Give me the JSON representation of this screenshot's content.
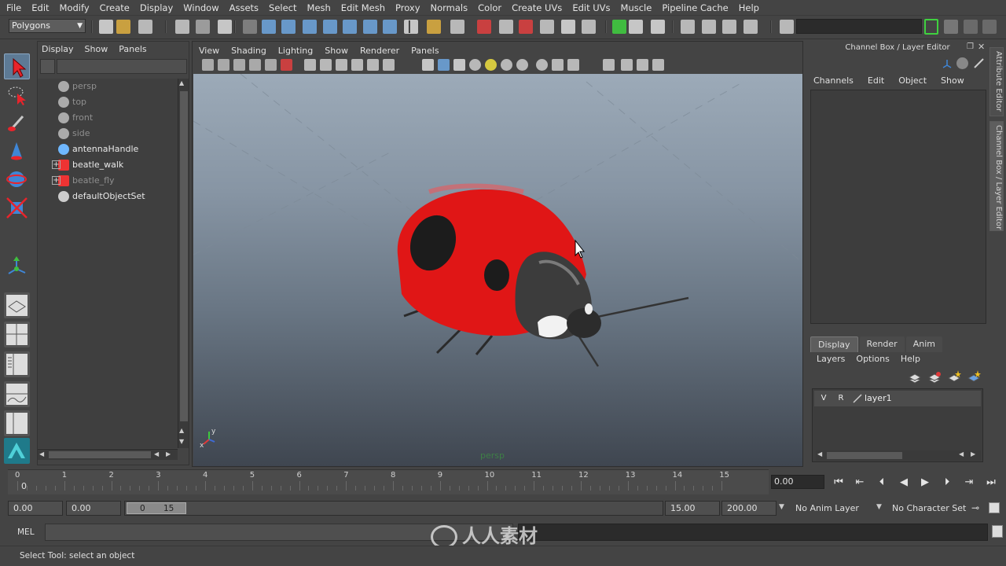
{
  "menubar": [
    "File",
    "Edit",
    "Modify",
    "Create",
    "Display",
    "Window",
    "Assets",
    "Select",
    "Mesh",
    "Edit Mesh",
    "Proxy",
    "Normals",
    "Color",
    "Create UVs",
    "Edit UVs",
    "Muscle",
    "Pipeline Cache",
    "Help"
  ],
  "statusline": {
    "mode": "Polygons"
  },
  "outliner": {
    "menu": [
      "Display",
      "Show",
      "Panels"
    ],
    "items": [
      {
        "label": "persp",
        "dim": true,
        "expandable": false
      },
      {
        "label": "top",
        "dim": true,
        "expandable": false
      },
      {
        "label": "front",
        "dim": true,
        "expandable": false
      },
      {
        "label": "side",
        "dim": true,
        "expandable": false
      },
      {
        "label": "antennaHandle",
        "dim": false,
        "expandable": false
      },
      {
        "label": "beatle_walk",
        "dim": false,
        "expandable": true
      },
      {
        "label": "beatle_fly",
        "dim": true,
        "expandable": true
      },
      {
        "label": "defaultObjectSet",
        "dim": false,
        "expandable": false
      }
    ]
  },
  "viewport": {
    "menu": [
      "View",
      "Shading",
      "Lighting",
      "Show",
      "Renderer",
      "Panels"
    ],
    "camera_label": "persp",
    "axis": {
      "y": "y",
      "x": "x"
    }
  },
  "channel_box": {
    "title": "Channel Box / Layer Editor",
    "menu": [
      "Channels",
      "Edit",
      "Object",
      "Show"
    ]
  },
  "layer_editor": {
    "tabs": [
      "Display",
      "Render",
      "Anim"
    ],
    "active_tab": "Display",
    "menu": [
      "Layers",
      "Options",
      "Help"
    ],
    "layers": [
      {
        "v": "V",
        "r": "R",
        "name": "layer1"
      }
    ]
  },
  "side_tabs": [
    "Attribute Editor",
    "Channel Box / Layer Editor"
  ],
  "timeline": {
    "ticks": [
      "0",
      "1",
      "2",
      "3",
      "4",
      "5",
      "6",
      "7",
      "8",
      "9",
      "10",
      "11",
      "12",
      "13",
      "14",
      "15"
    ],
    "current_frame_marker": "0",
    "current_time": "0.00"
  },
  "range": {
    "start": "0.00",
    "playback_start": "0.00",
    "slider_min": "0",
    "slider_max": "15",
    "playback_end": "15.00",
    "end": "200.00",
    "anim_layer": "No Anim Layer",
    "character_set": "No Character Set"
  },
  "mel": {
    "label": "MEL"
  },
  "helpline": {
    "text": "Select Tool: select an object"
  },
  "watermark": {
    "text": "人人素材"
  },
  "colors": {
    "ladybug_red": "#e01616",
    "ladybug_head": "#3a3a3a",
    "selection_blue": "#5d7a95"
  }
}
